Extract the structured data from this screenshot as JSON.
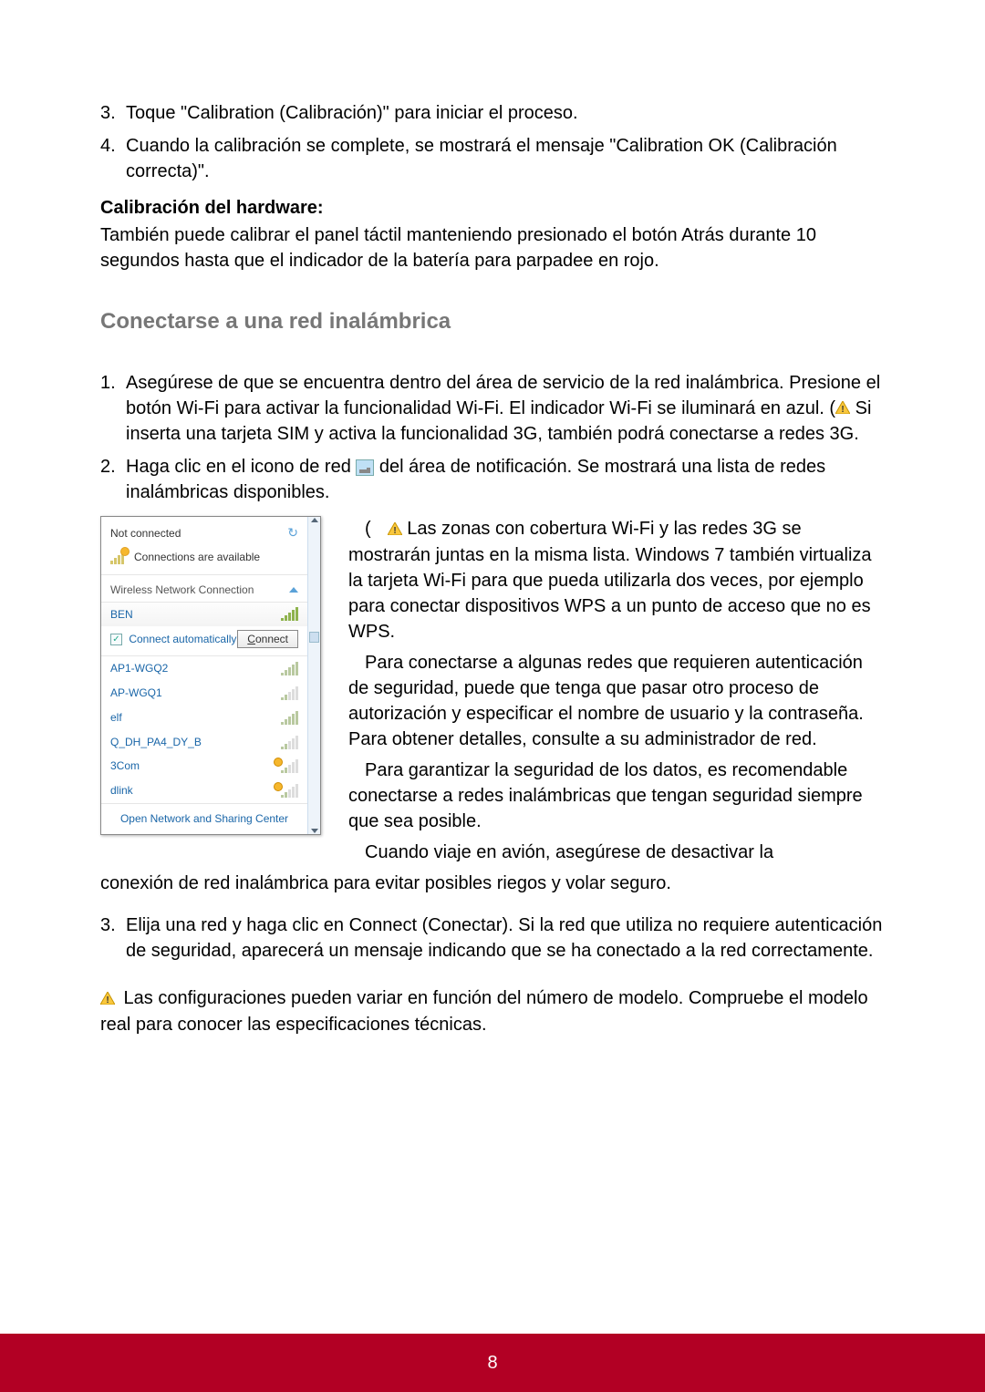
{
  "steps_top": [
    {
      "num": "3.",
      "text": "Toque \"Calibration (Calibración)\" para iniciar el proceso."
    },
    {
      "num": "4.",
      "text": "Cuando la calibración se complete, se mostrará el mensaje \"Calibration OK (Calibración correcta)\"."
    }
  ],
  "hardware_heading": "Calibración del hardware:",
  "hardware_text": "También puede calibrar el panel táctil manteniendo presionado el botón Atrás durante 10 segundos hasta que el indicador de la batería para parpadee en rojo.",
  "section_title": "Conectarse a una red inalámbrica",
  "wireless_steps": {
    "s1": {
      "num": "1.",
      "pre": "Asegúrese de que se encuentra dentro del área de servicio de la red inalámbrica. Presione el botón Wi-Fi para activar la funcionalidad Wi-Fi. El indicador Wi-Fi se iluminará en azul. (",
      "post": " Si inserta una tarjeta SIM y activa la funcionalidad 3G, también podrá conectarse a redes 3G."
    },
    "s2": {
      "num": "2.",
      "pre": "Haga clic en el icono de red ",
      "post": " del área de notificación. Se mostrará una lista de redes inalámbricas disponibles."
    },
    "s3": {
      "num": "3.",
      "text": "Elija una red y haga clic en Connect (Conectar). Si la red que utiliza no requiere autenticación de seguridad, aparecerá un mensaje indicando que se ha conectado a la red correctamente."
    }
  },
  "side_paragraphs": {
    "p1_pre": "(",
    "p1_post": " Las zonas con cobertura Wi-Fi y las redes 3G se mostrarán juntas en la misma lista. Windows 7 también virtualiza la tarjeta Wi-Fi para que pueda utilizarla dos veces, por ejemplo para conectar dispositivos WPS a un punto de acceso que no es WPS.",
    "p2": "Para conectarse a algunas redes que requieren autenticación de seguridad, puede que tenga que pasar otro proceso de autorización y especificar el nombre de usuario y la contraseña. Para obtener detalles, consulte a su administrador de red.",
    "p3": "Para garantizar la seguridad de los datos, es recomendable conectarse a redes inalámbricas que tengan seguridad siempre que sea posible.",
    "p4": "Cuando viaje en avión, asegúrese de desactivar la"
  },
  "continuation": "conexión de red inalámbrica para evitar posibles riegos y volar seguro.",
  "config_note": " Las configuraciones pueden variar en función del número de modelo. Compruebe el modelo real para conocer las especificaciones técnicas.",
  "popup": {
    "status": "Not connected",
    "available": "Connections are available",
    "section_label": "Wireless Network Connection",
    "selected_net": "BEN",
    "auto_label": "Connect automatically",
    "connect_btn": "Connect",
    "networks": [
      {
        "name": "AP1-WGQ2",
        "strength": "med"
      },
      {
        "name": "AP-WGQ1",
        "strength": "med"
      },
      {
        "name": "elf",
        "strength": "med"
      },
      {
        "name": "Q_DH_PA4_DY_B",
        "strength": "med"
      },
      {
        "name": "3Com",
        "strength": "shield"
      },
      {
        "name": "dlink",
        "strength": "shield"
      }
    ],
    "footer": "Open Network and Sharing Center"
  },
  "page_number": "8"
}
